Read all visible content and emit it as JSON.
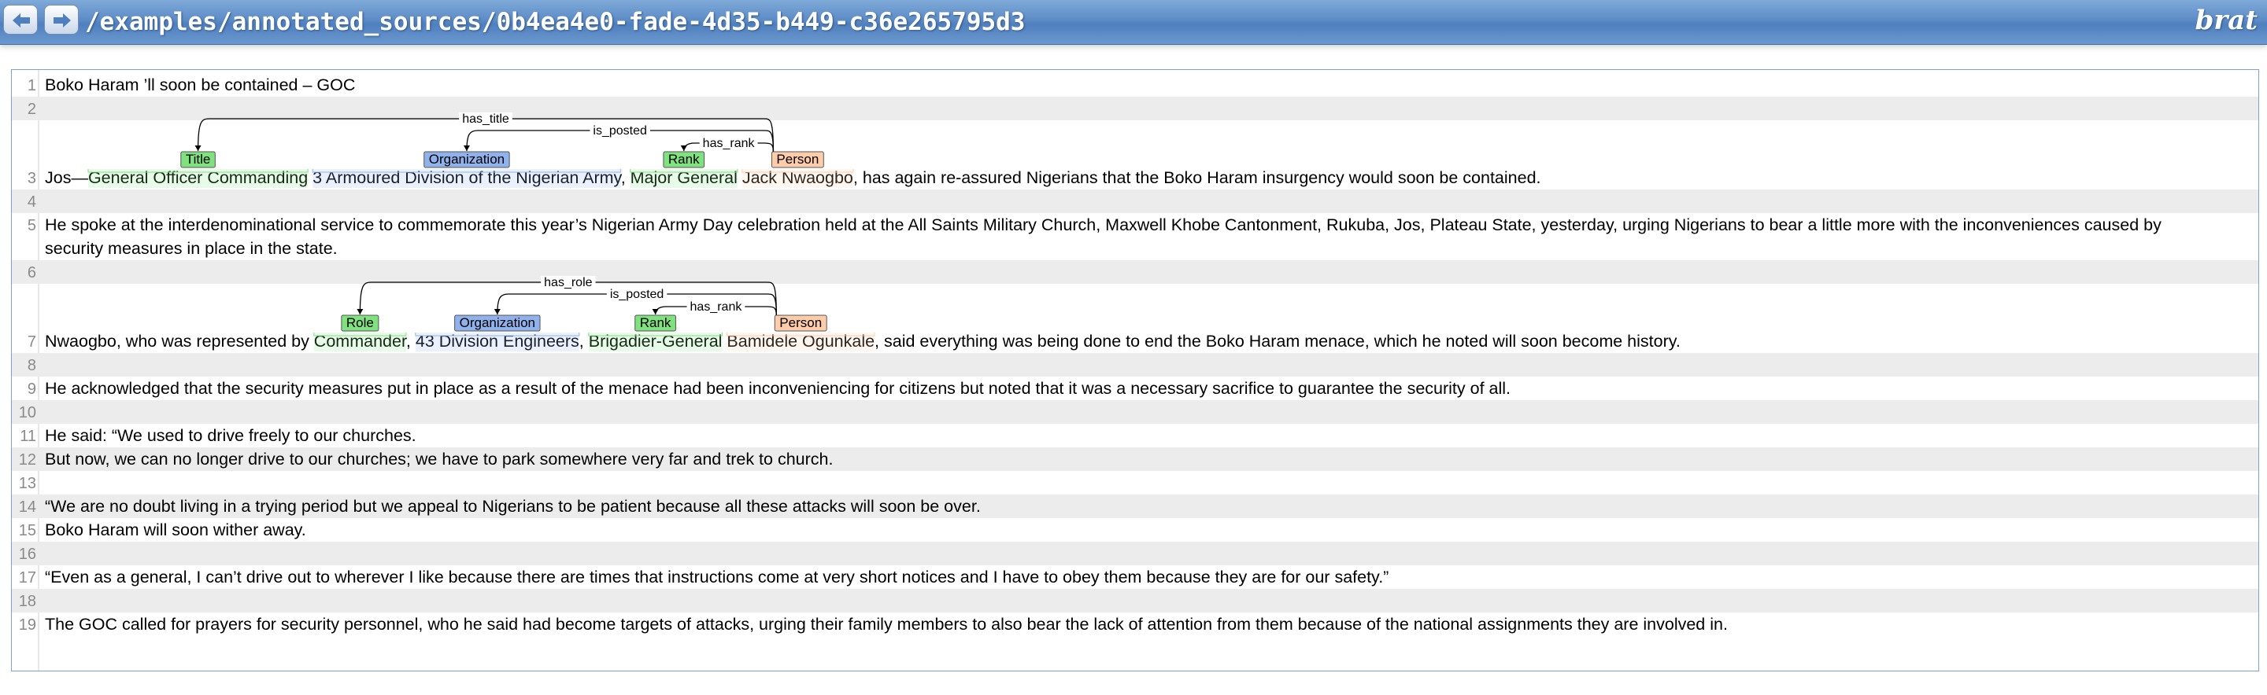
{
  "header": {
    "back_icon": "back-arrow-icon",
    "forward_icon": "forward-arrow-icon",
    "path": "/examples/annotated_sources/0b4ea4e0-fade-4d35-b449-c36e265795d3",
    "logo": "brat"
  },
  "colors": {
    "header": "#5d8cc6",
    "Title": "#7fe27f",
    "Role": "#7fe27f",
    "Rank": "#7fe27f",
    "Organization": "#8fb2ec",
    "Person": "#ffccaa",
    "row_alt": "#ececec",
    "panel_border": "#7f9fd6"
  },
  "document": {
    "lines": [
      {
        "n": "1",
        "text": [
          "Boko Haram ’ll soon be contained – GOC"
        ]
      },
      {
        "n": "2",
        "text": []
      },
      {
        "n": "3",
        "annotated": true,
        "text": [
          "Jos—General Officer Commanding 3 Armoured Division of the Nigerian Army, Major General Jack Nwaogbo, has again re-assured Nigerians that the Boko Haram insurgency would soon be contained."
        ]
      },
      {
        "n": "4",
        "text": []
      },
      {
        "n": "5",
        "text": [
          "He spoke at the interdenominational service to commemorate this year’s Nigerian Army Day celebration held at the All Saints Military Church, Maxwell Khobe Cantonment, Rukuba, Jos, Plateau State, yesterday, urging Nigerians to bear a little more with the inconveniences caused by",
          "security measures in place in the state."
        ]
      },
      {
        "n": "6",
        "text": []
      },
      {
        "n": "7",
        "annotated": true,
        "text": [
          "Nwaogbo, who was represented by Commander, 43 Division Engineers, Brigadier-General Bamidele Ogunkale, said everything was being done to end the Boko Haram menace, which he noted will soon become history."
        ]
      },
      {
        "n": "8",
        "text": []
      },
      {
        "n": "9",
        "text": [
          "He acknowledged that the security measures put in place as a result of the menace had been inconveniencing for citizens but noted that it was a necessary sacrifice to guarantee the security of all."
        ]
      },
      {
        "n": "10",
        "text": []
      },
      {
        "n": "11",
        "text": [
          "He said: “We used to drive freely to our churches."
        ]
      },
      {
        "n": "12",
        "text": [
          "But now, we can no longer drive to our churches; we have to park somewhere very far and trek to church."
        ]
      },
      {
        "n": "13",
        "text": []
      },
      {
        "n": "14",
        "text": [
          "“We are no doubt living in a trying period but we appeal to Nigerians to be patient because all these attacks will soon be over."
        ]
      },
      {
        "n": "15",
        "text": [
          "Boko Haram will soon wither away."
        ]
      },
      {
        "n": "16",
        "text": []
      },
      {
        "n": "17",
        "text": [
          "“Even as a general, I can’t drive out to wherever I like because there are times that instructions come at very short notices and I have to obey them because they are for our safety.”"
        ]
      },
      {
        "n": "18",
        "text": []
      },
      {
        "n": "19",
        "text": [
          "The GOC called for prayers for security personnel, who he said had become targets of attacks, urging their family members to also bear the lack of attention from them because of the national assignments they are involved in."
        ]
      }
    ],
    "annotations": {
      "3": {
        "entities": [
          {
            "type": "Title",
            "text": "General Officer Commanding"
          },
          {
            "type": "Organization",
            "text": "3 Armoured Division of the Nigerian Army"
          },
          {
            "type": "Rank",
            "text": "Major General"
          },
          {
            "type": "Person",
            "text": "Jack Nwaogbo"
          }
        ],
        "relations": [
          {
            "label": "has_title",
            "from": 3,
            "to": 0
          },
          {
            "label": "is_posted",
            "from": 3,
            "to": 1
          },
          {
            "label": "has_rank",
            "from": 3,
            "to": 2
          }
        ]
      },
      "7": {
        "entities": [
          {
            "type": "Role",
            "text": "Commander"
          },
          {
            "type": "Organization",
            "text": "43 Division Engineers"
          },
          {
            "type": "Rank",
            "text": "Brigadier-General"
          },
          {
            "type": "Person",
            "text": "Bamidele Ogunkale"
          }
        ],
        "relations": [
          {
            "label": "has_role",
            "from": 3,
            "to": 0
          },
          {
            "label": "is_posted",
            "from": 3,
            "to": 1
          },
          {
            "label": "has_rank",
            "from": 3,
            "to": 2
          }
        ]
      }
    }
  }
}
